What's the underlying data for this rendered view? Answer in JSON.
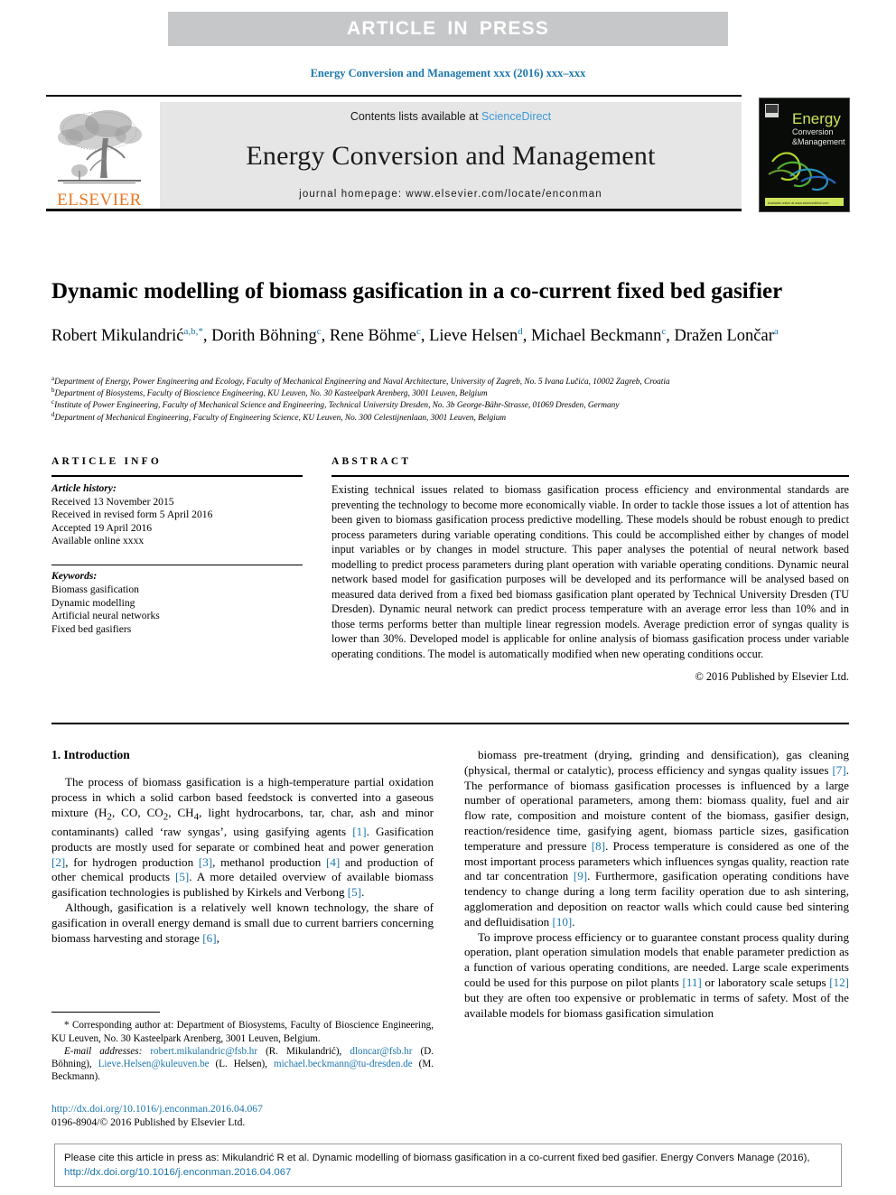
{
  "banner": {
    "text": "ARTICLE IN PRESS"
  },
  "running_head": "Energy Conversion and Management xxx (2016) xxx–xxx",
  "masthead": {
    "contents_prefix": "Contents lists available at ",
    "sciencedirect": "ScienceDirect",
    "journal_name": "Energy Conversion and Management",
    "homepage": "journal homepage: www.elsevier.com/locate/enconman",
    "publisher_word": "ELSEVIER",
    "cover_title_line1": "Energy",
    "cover_title_line2": "Conversion",
    "cover_title_line3": "&Management"
  },
  "article": {
    "title": "Dynamic modelling of biomass gasification in a co-current fixed bed gasifier",
    "authors": [
      {
        "name": "Robert Mikulandrić",
        "marks": "a,b,*",
        "sep": ", "
      },
      {
        "name": "Dorith Böhning",
        "marks": "c",
        "sep": ", "
      },
      {
        "name": "Rene Böhme",
        "marks": "c",
        "sep": ", "
      },
      {
        "name": "Lieve Helsen",
        "marks": "d",
        "sep": ", "
      },
      {
        "name": "Michael Beckmann",
        "marks": "c",
        "sep": ", "
      },
      {
        "name": "Dražen Lončar",
        "marks": "a",
        "sep": ""
      }
    ],
    "affiliations": [
      {
        "mark": "a",
        "text": "Department of Energy, Power Engineering and Ecology, Faculty of Mechanical Engineering and Naval Architecture, University of Zagreb, No. 5 Ivana Lučića, 10002 Zagreb, Croatia"
      },
      {
        "mark": "b",
        "text": "Department of Biosystems, Faculty of Bioscience Engineering, KU Leuven, No. 30 Kasteelpark Arenberg, 3001 Leuven, Belgium"
      },
      {
        "mark": "c",
        "text": "Institute of Power Engineering, Faculty of Mechanical Science and Engineering, Technical University Dresden, No. 3b George-Bähr-Strasse, 01069 Dresden, Germany"
      },
      {
        "mark": "d",
        "text": "Department of Mechanical Engineering, Faculty of Engineering Science, KU Leuven, No. 300 Celestijnenlaan, 3001 Leuven, Belgium"
      }
    ]
  },
  "article_info": {
    "heading": "ARTICLE INFO",
    "history_label": "Article history:",
    "history": [
      "Received 13 November 2015",
      "Received in revised form 5 April 2016",
      "Accepted 19 April 2016",
      "Available online xxxx"
    ],
    "keywords_label": "Keywords:",
    "keywords": [
      "Biomass gasification",
      "Dynamic modelling",
      "Artificial neural networks",
      "Fixed bed gasifiers"
    ]
  },
  "abstract": {
    "heading": "ABSTRACT",
    "body": "Existing technical issues related to biomass gasification process efficiency and environmental standards are preventing the technology to become more economically viable. In order to tackle those issues a lot of attention has been given to biomass gasification process predictive modelling. These models should be robust enough to predict process parameters during variable operating conditions. This could be accomplished either by changes of model input variables or by changes in model structure. This paper analyses the potential of neural network based modelling to predict process parameters during plant operation with variable operating conditions. Dynamic neural network based model for gasification purposes will be developed and its performance will be analysed based on measured data derived from a fixed bed biomass gasification plant operated by Technical University Dresden (TU Dresden). Dynamic neural network can predict process temperature with an average error less than 10% and in those terms performs better than multiple linear regression models. Average prediction error of syngas quality is lower than 30%. Developed model is applicable for online analysis of biomass gasification process under variable operating conditions. The model is automatically modified when new operating conditions occur.",
    "copyright": "© 2016 Published by Elsevier Ltd."
  },
  "body": {
    "section_title": "1. Introduction",
    "left_paragraphs": [
      "The process of biomass gasification is a high-temperature partial oxidation process in which a solid carbon based feedstock is converted into a gaseous mixture (H2, CO, CO2, CH4, light hydrocarbons, tar, char, ash and minor contaminants) called ‘raw syngas’, using gasifying agents [1]. Gasification products are mostly used for separate or combined heat and power generation [2], for hydrogen production [3], methanol production [4] and production of other chemical products [5]. A more detailed overview of available biomass gasification technologies is published by Kirkels and Verbong [5].",
      "Although, gasification is a relatively well known technology, the share of gasification in overall energy demand is small due to current barriers concerning biomass harvesting and storage [6],"
    ],
    "right_paragraphs": [
      "biomass pre-treatment (drying, grinding and densification), gas cleaning (physical, thermal or catalytic), process efficiency and syngas quality issues [7]. The performance of biomass gasification processes is influenced by a large number of operational parameters, among them: biomass quality, fuel and air flow rate, composition and moisture content of the biomass, gasifier design, reaction/residence time, gasifying agent, biomass particle sizes, gasification temperature and pressure [8]. Process temperature is considered as one of the most important process parameters which influences syngas quality, reaction rate and tar concentration [9]. Furthermore, gasification operating conditions have tendency to change during a long term facility operation due to ash sintering, agglomeration and deposition on reactor walls which could cause bed sintering and defluidisation [10].",
      "To improve process efficiency or to guarantee constant process quality during operation, plant operation simulation models that enable parameter prediction as a function of various operating conditions, are needed. Large scale experiments could be used for this purpose on pilot plants [11] or laboratory scale setups [12] but they are often too expensive or problematic in terms of safety. Most of the available models for biomass gasification simulation"
    ]
  },
  "footnote": {
    "corresponding": "* Corresponding author at: Department of Biosystems, Faculty of Bioscience Engineering, KU Leuven, No. 30 Kasteelpark Arenberg, 3001 Leuven, Belgium.",
    "email_label": "E-mail addresses:",
    "emails": [
      {
        "email": "robert.mikulandric@fsb.hr",
        "who": "(R. Mikulandrić),"
      },
      {
        "email": "dloncar@fsb.hr",
        "who": "(D. Böhning),"
      },
      {
        "email": "Lieve.Helsen@kuleuven.be",
        "who": "(L. Helsen),"
      },
      {
        "email": "michael.beckmann@tu-dresden.de",
        "who": "(M. Beckmann)."
      }
    ],
    "doi_url": "http://dx.doi.org/10.1016/j.enconman.2016.04.067",
    "issn_line": "0196-8904/© 2016 Published by Elsevier Ltd."
  },
  "cite_footer": {
    "text": "Please cite this article in press as: Mikulandrić R et al. Dynamic modelling of biomass gasification in a co-current fixed bed gasifier. Energy Convers Manage (2016), ",
    "doi_url": "http://dx.doi.org/10.1016/j.enconman.2016.04.067"
  },
  "colors": {
    "link": "#1c76ad",
    "elsevier_orange": "#e87722",
    "banner_grey": "#c6c7c9",
    "box_grey": "#e6e6e6"
  }
}
